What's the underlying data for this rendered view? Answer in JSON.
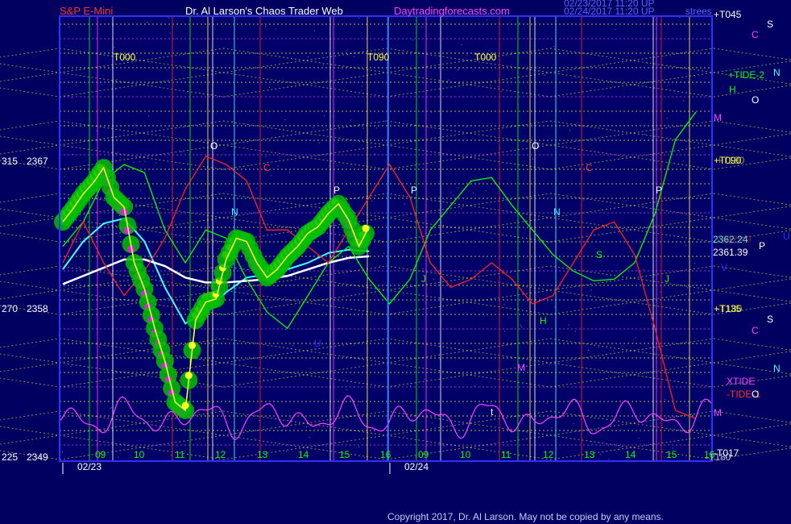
{
  "header": {
    "instrument": "S&P E-Mini",
    "title": "Dr. Al Larson's Chaos Trader Web",
    "website": "Daytradingforecasts.com",
    "stamp_line1": "02/23/2017 11:20 UP",
    "stamp_line2": "02/24/2017 11:20 UP"
  },
  "footer": {
    "copyright": "Copyright 2017, Dr. Al Larson. May not be copied by any means."
  },
  "colors": {
    "background": "#000060",
    "frame": "#3030ff",
    "grid_yellow": "#ffff40",
    "magenta": "#ff40ff",
    "green": "#00ff00",
    "red": "#ff2020",
    "cyan": "#40ffff",
    "white": "#ffffff",
    "label_red": "#ff3030",
    "label_magenta": "#ff40ff"
  },
  "left_axis": [
    {
      "deg": "315",
      "price": "2367"
    },
    {
      "deg": "270",
      "price": "2358"
    },
    {
      "deg": "225",
      "price": "2349"
    }
  ],
  "right_labels": {
    "top": "+T045",
    "upper": "+T090",
    "upper_overlap": "+T180",
    "lower": "+T135",
    "lower_overlap": "-T180",
    "tide2": "+TIDE-2",
    "xtide": "XTIDE",
    "tide": "-TIDE-1",
    "bottom": "-T017",
    "bottom2": "-T180",
    "corner": "strees",
    "price1": "2362.24",
    "price1_overlap": "2362.49",
    "price2": "2361.39"
  },
  "planet_letters": {
    "c1": "C",
    "s1": "S",
    "n1": "N",
    "o1": "O",
    "h1": "H",
    "m1": "M",
    "p_right": "P",
    "u_right": "U",
    "v_right": "V",
    "c2": "C",
    "s2": "S",
    "n2": "N",
    "o2": "O",
    "m2": "M"
  },
  "chart_annotations": {
    "t000_a": "T000",
    "t090": "T090",
    "t000_b": "T000",
    "o_a": "O",
    "o_b": "O",
    "p_a": "P",
    "p_b": "P",
    "p_c": "P",
    "c_a": "C",
    "c_b": "C",
    "n_a": "N",
    "n_b": "N",
    "j_a": "J",
    "j_b": "J",
    "h_a": "H",
    "m_a": "M",
    "s_a": "S",
    "u_a": "U",
    "t_a": "t"
  },
  "chart_data": {
    "type": "line",
    "title": "S&P E-Mini",
    "y_axis_labels": [
      {
        "angle": 315,
        "price": 2367
      },
      {
        "angle": 270,
        "price": 2358
      },
      {
        "angle": 225,
        "price": 2349
      }
    ],
    "ylim": [
      2349,
      2370
    ],
    "dates": [
      "02/23",
      "02/24"
    ],
    "hour_ticks": {
      "day1": [
        "09",
        "10",
        "11",
        "12",
        "13",
        "14",
        "15",
        "16"
      ],
      "day2": [
        "09",
        "10",
        "11",
        "12",
        "13",
        "14",
        "15",
        "16"
      ]
    },
    "series": [
      {
        "color": "#ffff40",
        "x": [
          0,
          0.25,
          0.5,
          0.75,
          1.0,
          1.25,
          1.5,
          1.75,
          2.0,
          2.25,
          2.5,
          2.75,
          3.0,
          3.25,
          3.5,
          3.75,
          4.0,
          4.25,
          4.5,
          4.75,
          5.0,
          5.25,
          5.5,
          5.75,
          6.0,
          6.25,
          6.5,
          6.75,
          7.0,
          7.25,
          7.5
        ],
        "values": [
          2363.5,
          2364.3,
          2365.2,
          2365.9,
          2366.8,
          2365.0,
          2364.4,
          2361.0,
          2359.4,
          2357.0,
          2355.0,
          2352.5,
          2352.0,
          2357.5,
          2358.6,
          2358.8,
          2361.2,
          2362.5,
          2362.3,
          2361.0,
          2360.1,
          2360.6,
          2361.4,
          2362.0,
          2362.8,
          2363.2,
          2364.0,
          2364.6,
          2363.6,
          2362.0,
          2363.2
        ]
      },
      {
        "color": "#40ffff",
        "x": [
          0,
          0.5,
          1.0,
          1.5,
          2.0,
          2.5,
          3.0,
          3.5,
          4.0,
          4.5,
          5.0,
          5.5,
          6.0,
          6.5,
          7.0,
          7.5
        ],
        "values": [
          2360.6,
          2362.3,
          2363.4,
          2363.7,
          2362.3,
          2359.5,
          2357.3,
          2358.0,
          2359.2,
          2360.1,
          2360.3,
          2360.6,
          2361.0,
          2361.6,
          2361.8,
          2361.7
        ]
      },
      {
        "color": "#ffffff",
        "x": [
          0,
          0.5,
          1.0,
          1.5,
          2.0,
          2.5,
          3.0,
          3.5,
          4.0,
          4.5,
          5.0,
          5.5,
          6.0,
          6.5,
          7.0,
          7.5
        ],
        "values": [
          2359.7,
          2360.2,
          2360.7,
          2361.2,
          2361.2,
          2360.8,
          2360.1,
          2359.8,
          2359.8,
          2359.9,
          2360.0,
          2360.2,
          2360.6,
          2361.0,
          2361.3,
          2361.4
        ]
      },
      {
        "color": "#00ff00",
        "x": [
          0,
          0.5,
          1.0,
          1.5,
          2.0,
          2.5,
          3.0,
          3.5,
          4.0,
          4.5,
          5.0,
          5.5,
          6.0,
          6.5,
          7.0,
          7.5,
          8.0,
          8.5,
          9.0,
          9.5,
          10.0,
          10.5,
          11.0,
          11.5,
          12.0,
          12.5,
          13.0,
          13.5,
          14.0,
          14.5,
          15.0,
          15.5
        ],
        "values": [
          2362.0,
          2363.5,
          2366.0,
          2367.0,
          2366.5,
          2363.0,
          2361.0,
          2363.0,
          2362.5,
          2360.0,
          2358.0,
          2357.0,
          2359.0,
          2361.0,
          2362.0,
          2360.0,
          2358.5,
          2360.0,
          2363.0,
          2364.5,
          2366.0,
          2366.2,
          2364.5,
          2363.0,
          2361.5,
          2360.5,
          2359.9,
          2360.0,
          2361.0,
          2364.0,
          2368.5,
          2370.2
        ]
      },
      {
        "color": "#ff2020",
        "x": [
          0,
          0.5,
          1.0,
          1.5,
          2.0,
          2.5,
          3.0,
          3.5,
          4.0,
          4.5,
          5.0,
          5.5,
          6.0,
          6.5,
          7.0,
          7.5,
          8.0,
          8.5,
          9.0,
          9.5,
          10.0,
          10.5,
          11.0,
          11.5,
          12.0,
          12.5,
          13.0,
          13.5,
          14.0,
          14.5,
          15.0,
          15.5
        ],
        "values": [
          2361.0,
          2363.5,
          2361.0,
          2359.0,
          2360.5,
          2362.5,
          2365.5,
          2367.5,
          2367.0,
          2366.0,
          2363.0,
          2363.0,
          2362.0,
          2361.0,
          2363.0,
          2365.0,
          2367.0,
          2365.0,
          2361.0,
          2359.5,
          2360.0,
          2361.0,
          2360.0,
          2358.5,
          2359.0,
          2361.0,
          2363.0,
          2363.5,
          2361.5,
          2357.0,
          2352.0,
          2351.5
        ]
      }
    ]
  }
}
